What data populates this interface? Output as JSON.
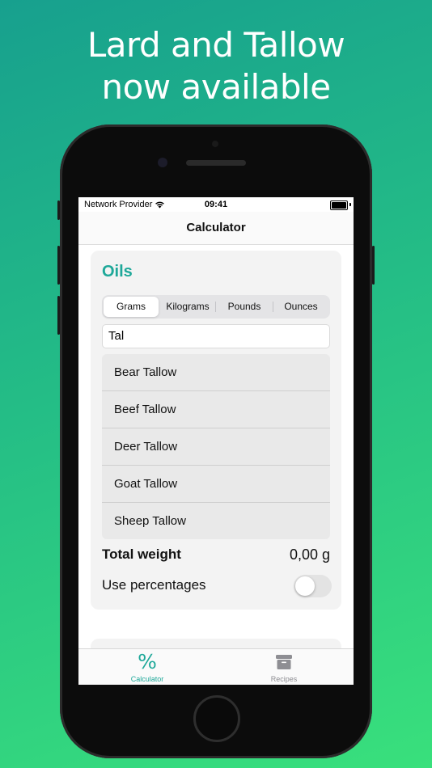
{
  "headline": {
    "line1": "Lard and Tallow",
    "line2": "now available"
  },
  "status_bar": {
    "carrier": "Network Provider",
    "time": "09:41"
  },
  "nav": {
    "title": "Calculator"
  },
  "oils": {
    "title": "Oils",
    "units": [
      "Grams",
      "Kilograms",
      "Pounds",
      "Ounces"
    ],
    "selected_unit": "Grams",
    "search_value": "Tal",
    "suggestions": [
      "Bear Tallow",
      "Beef Tallow",
      "Deer Tallow",
      "Goat Tallow",
      "Sheep Tallow"
    ],
    "total_label": "Total weight",
    "total_value": "0,00 g",
    "percentages_label": "Use percentages",
    "percentages_enabled": false
  },
  "tab_bar": {
    "tabs": [
      {
        "label": "Calculator",
        "icon": "percent-icon",
        "active": true
      },
      {
        "label": "Recipes",
        "icon": "archive-box-icon",
        "active": false
      }
    ]
  },
  "colors": {
    "accent": "#1ea899",
    "background_start": "#17a08e",
    "background_end": "#39e07c"
  }
}
